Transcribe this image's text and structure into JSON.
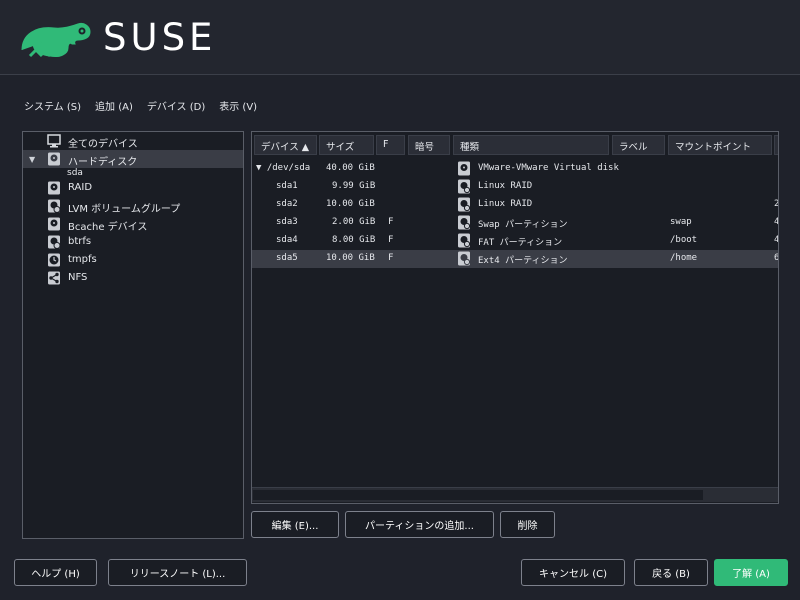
{
  "brand": {
    "name": "SUSE"
  },
  "menu": {
    "items": [
      "システム (S)",
      "追加 (A)",
      "デバイス (D)",
      "表示 (V)"
    ]
  },
  "tree": {
    "all_devices": "全てのデバイス",
    "hard_disks": "ハードディスク",
    "sda": "sda",
    "raid": "RAID",
    "lvm": "LVM ボリュームグループ",
    "bcache": "Bcache デバイス",
    "btrfs": "btrfs",
    "tmpfs": "tmpfs",
    "nfs": "NFS"
  },
  "table": {
    "headers": {
      "device": "デバイス ▲",
      "size": "サイズ",
      "f": "F",
      "encrypted": "暗号",
      "type": "種類",
      "label": "ラベル",
      "mount": "マウントポイント"
    },
    "rows": [
      {
        "device": "▼ /dev/sda",
        "size": "40.00 GiB",
        "f": "",
        "type": "VMware-VMware Virtual disk",
        "mount": "",
        "extra": ""
      },
      {
        "device": "sda1",
        "size": "9.99 GiB",
        "f": "",
        "type": "Linux RAID",
        "mount": "",
        "extra": ""
      },
      {
        "device": "sda2",
        "size": "10.00 GiB",
        "f": "",
        "type": "Linux RAID",
        "mount": "",
        "extra": "2"
      },
      {
        "device": "sda3",
        "size": "2.00 GiB",
        "f": "F",
        "type": "Swap パーティション",
        "mount": "swap",
        "extra": "4"
      },
      {
        "device": "sda4",
        "size": "8.00 GiB",
        "f": "F",
        "type": "FAT パーティション",
        "mount": "/boot",
        "extra": "4"
      },
      {
        "device": "sda5",
        "size": "10.00 GiB",
        "f": "F",
        "type": "Ext4 パーティション",
        "mount": "/home",
        "extra": "6"
      }
    ]
  },
  "actions": {
    "edit": "編集 (E)...",
    "add_partition": "パーティションの追加...",
    "delete": "削除"
  },
  "footer": {
    "help": "ヘルプ (H)",
    "release_notes": "リリースノート (L)...",
    "cancel": "キャンセル (C)",
    "back": "戻る (B)",
    "ok": "了解 (A)"
  },
  "colors": {
    "accent": "#30ba78",
    "background": "#1f222b",
    "selection": "#3a3d46"
  }
}
